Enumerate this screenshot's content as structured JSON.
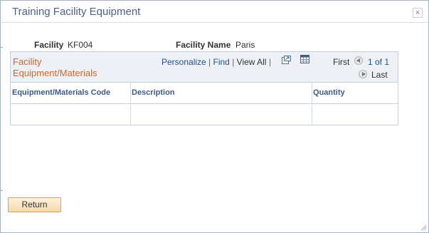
{
  "dialog": {
    "title": "Training Facility Equipment",
    "close_label": "×"
  },
  "fields": {
    "facility_label": "Facility",
    "facility_value": "KF004",
    "facility_name_label": "Facility Name",
    "facility_name_value": "Paris"
  },
  "grid": {
    "title": "Facility Equipment/Materials",
    "personalize": "Personalize",
    "find": "Find",
    "separator": "|",
    "view_all": "View All",
    "first": "First",
    "page_info": "1 of 1",
    "last": "Last",
    "columns": [
      "Equipment/Materials Code",
      "Description",
      "Quantity"
    ],
    "rows": [
      {
        "code": "",
        "description": "",
        "quantity": ""
      }
    ]
  },
  "actions": {
    "return_label": "Return"
  },
  "icons": {
    "close": "close-icon",
    "new_window": "new-window-icon",
    "spreadsheet": "spreadsheet-icon",
    "prev": "previous-arrow-icon",
    "next": "next-arrow-icon",
    "resize": "resize-grip-icon"
  },
  "colors": {
    "title": "#4d6182",
    "grid_title": "#c7682d",
    "link": "#1e4f8c",
    "column_header": "#3d5985",
    "button_bg": "#f7d9aa",
    "button_border": "#d8a15c"
  }
}
